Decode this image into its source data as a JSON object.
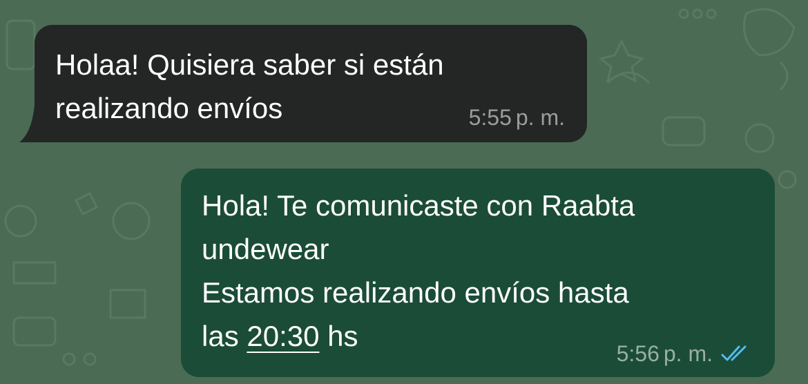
{
  "chat": {
    "messages": [
      {
        "direction": "incoming",
        "text": "Holaa! Quisiera saber si están\nrealizando envíos",
        "time": "5:55",
        "ampm": "p. m."
      },
      {
        "direction": "outgoing",
        "lines": [
          "Hola! Te comunicaste con Raabta",
          "undewear",
          "Estamos realizando envíos hasta"
        ],
        "last_line_prefix": "las ",
        "last_line_link": "20:30",
        "last_line_suffix": " hs",
        "time": "5:56",
        "ampm": "p. m.",
        "status_icon": "double-check-read-icon"
      }
    ]
  },
  "colors": {
    "wallpaper": "#4b6b55",
    "incoming_bubble": "#232624",
    "outgoing_bubble": "#1b4c38",
    "read_ticks": "#53bdeb"
  }
}
